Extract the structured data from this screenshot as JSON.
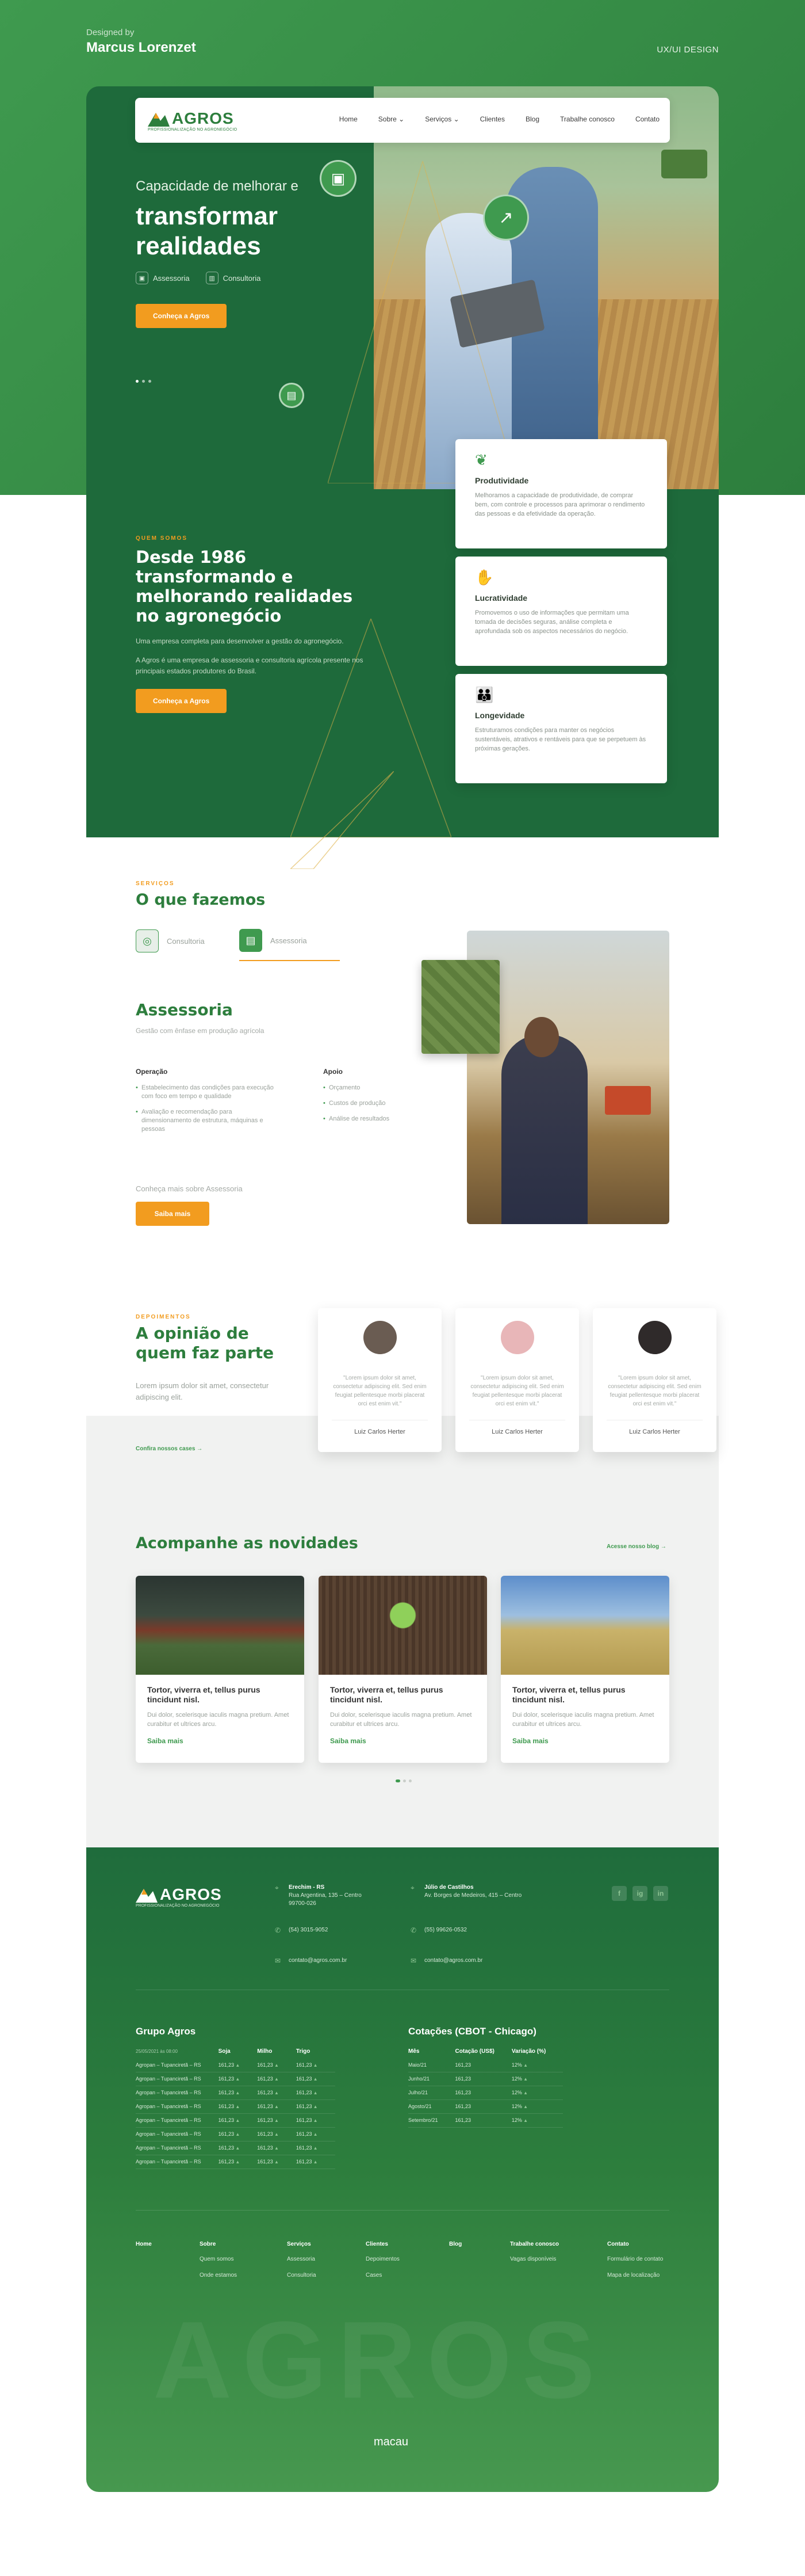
{
  "presentation": {
    "designed_by": "Designed by",
    "designer": "Marcus Lorenzet",
    "tag": "UX/UI DESIGN"
  },
  "brand": {
    "name": "AGROS",
    "tagline": "PROFISSIONALIZAÇÃO NO AGRONEGÓCIO",
    "green": "#2d7e3d",
    "dark_green": "#1e6a3b",
    "orange": "#f29c1f"
  },
  "nav": {
    "items": [
      "Home",
      "Sobre ⌄",
      "Serviços ⌄",
      "Clientes",
      "Blog",
      "Trabalhe conosco",
      "Contato"
    ]
  },
  "hero": {
    "pre": "Capacidade de melhorar e",
    "title_line1": "transformar",
    "title_line2": "realidades",
    "tabs": [
      {
        "icon": "briefcase-icon",
        "label": "Assessoria"
      },
      {
        "icon": "chart-icon",
        "label": "Consultoria"
      }
    ],
    "cta": "Conheça a Agros"
  },
  "about": {
    "kicker": "QUEM SOMOS",
    "title": "Desde 1986 transformando e melhorando realidades no agronegócio",
    "p1": "Uma empresa completa para desenvolver a gestão do agronegócio.",
    "p2": "A Agros é uma empresa de assessoria e consultoria agrícola presente nos principais estados produtores do Brasil.",
    "cta": "Conheça a Agros",
    "cards": [
      {
        "icon": "sprout-icon",
        "title": "Produtividade",
        "text": "Melhoramos a capacidade de produtividade, de comprar bem, com controle e processos para aprimorar o rendimento das pessoas e da efetividade da operação."
      },
      {
        "icon": "money-hand-icon",
        "title": "Lucratividade",
        "text": "Promovemos o uso de informações que permitam uma tomada de decisões seguras, análise completa e aprofundada sob os aspectos necessários do negócio."
      },
      {
        "icon": "people-icon",
        "title": "Longevidade",
        "text": "Estruturamos condições para manter os negócios sustentáveis, atrativos e rentáveis para que se perpetuem às próximas gerações."
      }
    ]
  },
  "services": {
    "kicker": "SERVIÇOS",
    "title": "O que fazemos",
    "tabs": [
      "Consultoria",
      "Assessoria"
    ],
    "heading": "Assessoria",
    "subheading": "Gestão com ênfase em produção agrícola",
    "col1_title": "Operação",
    "col1_items": [
      "Estabelecimento das condições para execução com foco em tempo e qualidade",
      "Avaliação e recomendação para dimensionamento de estrutura, máquinas e pessoas"
    ],
    "col2_title": "Apoio",
    "col2_items": [
      "Orçamento",
      "Custos de produção",
      "Análise de resultados"
    ],
    "more": "Conheça mais sobre Assessoria",
    "cta": "Saiba mais"
  },
  "testimonials": {
    "kicker": "DEPOIMENTOS",
    "title": "A opinião de quem faz parte",
    "desc": "Lorem ipsum dolor sit amet, consectetur adipiscing elit.",
    "link": "Confira nossos cases  →",
    "cards": [
      {
        "text": "\"Lorem ipsum dolor sit amet, consectetur adipiscing elit. Sed enim feugiat pellentesque morbi placerat orci est enim vit.\"",
        "name": "Luiz Carlos Herter"
      },
      {
        "text": "\"Lorem ipsum dolor sit amet, consectetur adipiscing elit. Sed enim feugiat pellentesque morbi placerat orci est enim vit.\"",
        "name": "Luiz Carlos Herter"
      },
      {
        "text": "\"Lorem ipsum dolor sit amet, consectetur adipiscing elit. Sed enim feugiat pellentesque morbi placerat orci est enim vit.\"",
        "name": "Luiz Carlos Herter"
      }
    ]
  },
  "news": {
    "title": "Acompanhe as novidades",
    "link": "Acesse nosso blog  →",
    "cards": [
      {
        "title": "Tortor, viverra et, tellus purus tincidunt nisl.",
        "text": "Dui dolor, scelerisque iaculis magna pretium. Amet curabitur et ultrices arcu.",
        "more": "Saiba mais"
      },
      {
        "title": "Tortor, viverra et, tellus purus tincidunt nisl.",
        "text": "Dui dolor, scelerisque iaculis magna pretium. Amet curabitur et ultrices arcu.",
        "more": "Saiba mais"
      },
      {
        "title": "Tortor, viverra et, tellus purus tincidunt nisl.",
        "text": "Dui dolor, scelerisque iaculis magna pretium. Amet curabitur et ultrices arcu.",
        "more": "Saiba mais"
      }
    ]
  },
  "footer": {
    "office1": {
      "city": "Erechim - RS",
      "address": "Rua Argentina, 135 – Centro 99700-026",
      "phone": "(54) 3015-9052",
      "email": "contato@agros.com.br"
    },
    "office2": {
      "city": "Júlio de Castilhos",
      "address": "Av. Borges de Medeiros, 415 – Centro",
      "phone": "(55) 99626-0532",
      "email": "contato@agros.com.br"
    },
    "social": [
      "f",
      "ig",
      "in"
    ],
    "group_title": "Grupo Agros",
    "group_date": "25/05/2021 às 08:00",
    "group_cols": [
      "Soja",
      "Milho",
      "Trigo"
    ],
    "group_rows": [
      [
        "Agropan – Tupanciretã – RS",
        "161,23",
        "161,23",
        "161,23"
      ],
      [
        "Agropan – Tupanciretã – RS",
        "161,23",
        "161,23",
        "161,23"
      ],
      [
        "Agropan – Tupanciretã – RS",
        "161,23",
        "161,23",
        "161,23"
      ],
      [
        "Agropan – Tupanciretã – RS",
        "161,23",
        "161,23",
        "161,23"
      ],
      [
        "Agropan – Tupanciretã – RS",
        "161,23",
        "161,23",
        "161,23"
      ],
      [
        "Agropan – Tupanciretã – RS",
        "161,23",
        "161,23",
        "161,23"
      ],
      [
        "Agropan – Tupanciretã – RS",
        "161,23",
        "161,23",
        "161,23"
      ],
      [
        "Agropan – Tupanciretã – RS",
        "161,23",
        "161,23",
        "161,23"
      ]
    ],
    "cbot_title": "Cotações (CBOT - Chicago)",
    "cbot_cols": [
      "Mês",
      "Cotação (US$)",
      "Variação (%)"
    ],
    "cbot_rows": [
      [
        "Maio/21",
        "161,23",
        "12%"
      ],
      [
        "Junho/21",
        "161,23",
        "12%"
      ],
      [
        "Julho/21",
        "161,23",
        "12%"
      ],
      [
        "Agosto/21",
        "161,23",
        "12%"
      ],
      [
        "Setembro/21",
        "161,23",
        "12%"
      ]
    ],
    "nav": [
      {
        "title": "Home",
        "items": []
      },
      {
        "title": "Sobre",
        "items": [
          "Quem somos",
          "Onde estamos"
        ]
      },
      {
        "title": "Serviços",
        "items": [
          "Assessoria",
          "Consultoria"
        ]
      },
      {
        "title": "Clientes",
        "items": [
          "Depoimentos",
          "Cases"
        ]
      },
      {
        "title": "Blog",
        "items": []
      },
      {
        "title": "Trabalhe conosco",
        "items": [
          "Vagas disponíveis"
        ]
      },
      {
        "title": "Contato",
        "items": [
          "Formulário de contato",
          "Mapa de localização"
        ]
      }
    ],
    "watermark": "AGROS",
    "credit": "macau"
  }
}
